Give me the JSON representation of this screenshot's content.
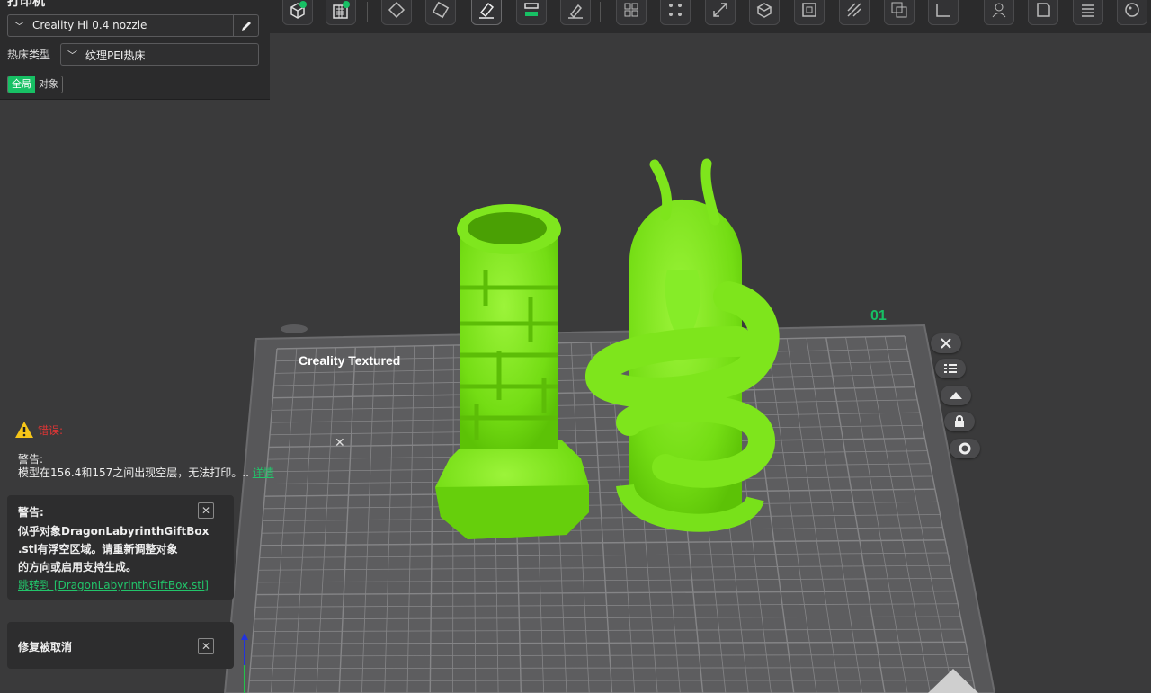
{
  "printer_panel": {
    "header": "打印机",
    "nozzle_value": "Creality Hi 0.4 nozzle",
    "bed_label": "热床类型",
    "bed_value": "纹理PEI热床",
    "scope_global": "全局",
    "scope_object": "对象"
  },
  "toolbar": {
    "buttons": [
      "add-object-icon",
      "add-plate-icon",
      "arrange-icon",
      "orient-icon",
      "erase-icon",
      "split-icon",
      "support-paint-icon",
      "layout-grid-icon",
      "layout-dots-icon",
      "scale-icon",
      "cut-icon",
      "hollow-icon",
      "seam-icon",
      "boolean-icon",
      "measure-icon",
      "assembly-icon",
      "emboss-icon",
      "layers-icon",
      "color-paint-icon"
    ]
  },
  "plate": {
    "label": "Creality Textured",
    "number": "01"
  },
  "notifications": {
    "error": {
      "label": "错误:",
      "title": "警告:",
      "message": "模型在156.4和157之间出现空层，无法打印。..",
      "link": "详情"
    },
    "warning": {
      "title": "警告:",
      "line1": "似乎对象DragonLabyrinthGiftBox",
      "line2": ".stl有浮空区域。请重新调整对象",
      "line3": "的方向或启用支持生成。",
      "link": "跳转到 [DragonLabyrinthGiftBox.stl]"
    },
    "cancel": {
      "text": "修复被取消"
    }
  },
  "colors": {
    "model": "#7ee51c",
    "accent": "#17c064",
    "plate": "#5b5b5d",
    "background": "#3a3a3b"
  }
}
